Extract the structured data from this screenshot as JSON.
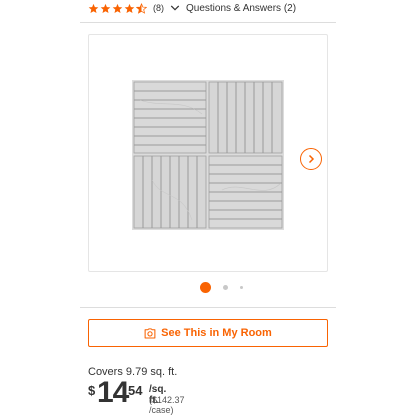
{
  "rating": {
    "stars_value": 4.5,
    "stars_max": 5,
    "review_count": "(8)",
    "qa_label": "Questions & Answers (2)"
  },
  "gallery": {
    "current_index": 1,
    "total_indicators": 3,
    "next_icon": "chevron-right-icon"
  },
  "actions": {
    "room_label": "See This in My Room",
    "room_icon": "camera-icon"
  },
  "pricing": {
    "coverage": "Covers 9.79 sq. ft.",
    "currency": "$",
    "whole": "14",
    "cents": "54",
    "unit": "/sq. ft.",
    "case_price": "($142.37 /case)"
  },
  "colors": {
    "accent": "#f96302",
    "star": "#f96302",
    "tile_base": "#d8d8d8",
    "tile_seam": "#9a9a9a"
  }
}
